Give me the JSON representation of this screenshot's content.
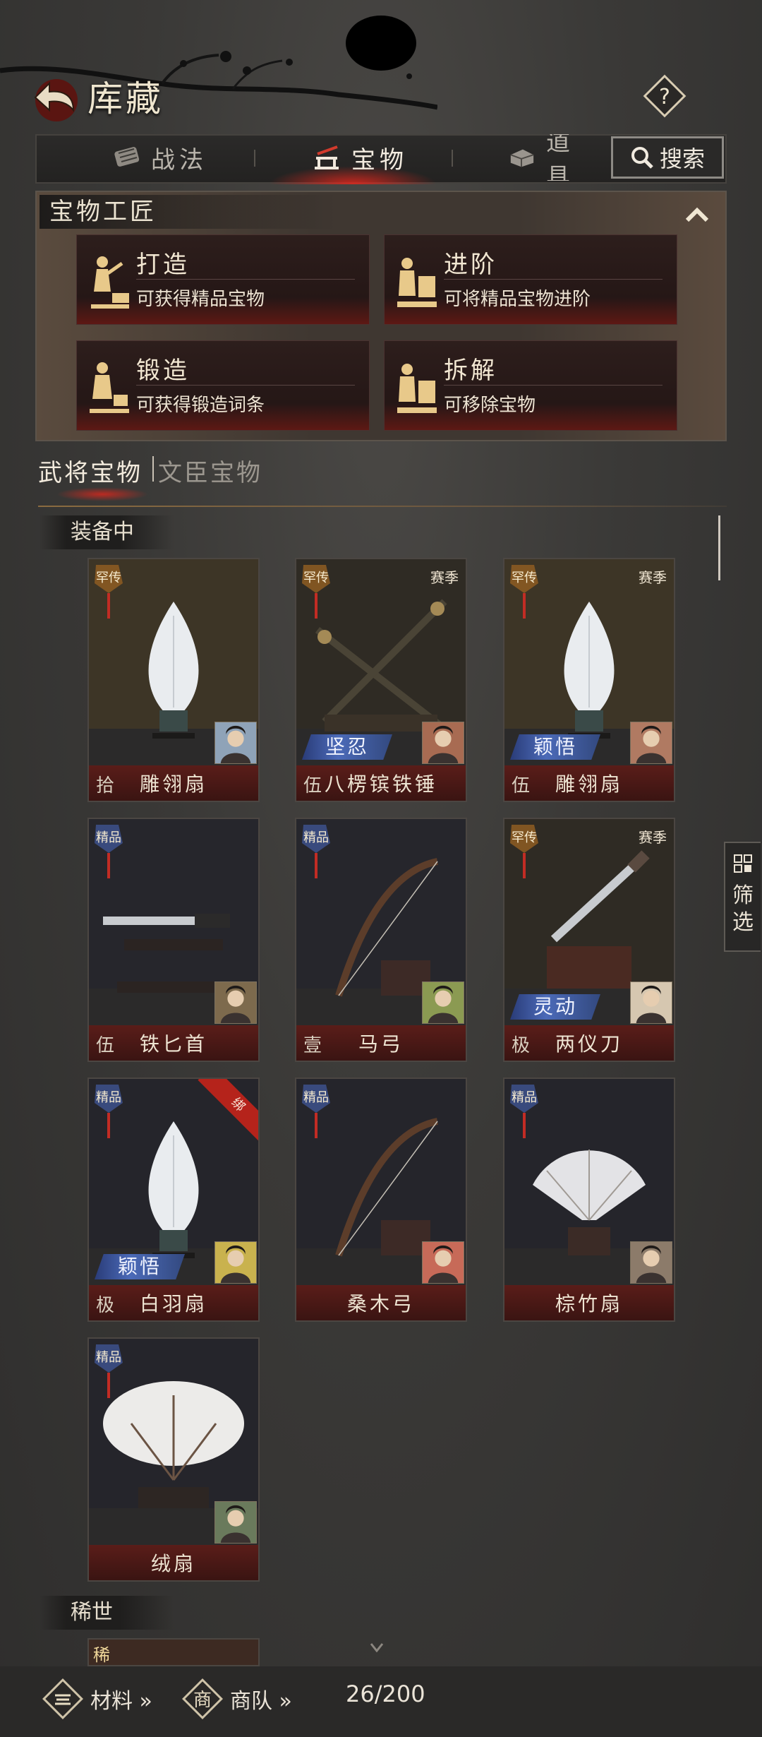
{
  "header": {
    "title": "库藏"
  },
  "tabs": [
    {
      "label": "战法",
      "icon": "scroll-icon"
    },
    {
      "label": "宝物",
      "icon": "sword-stand-icon",
      "active": true
    },
    {
      "label": "道具",
      "icon": "item-box-icon"
    }
  ],
  "search": {
    "label": "搜索"
  },
  "artisan": {
    "title": "宝物工匠",
    "cards": [
      {
        "name": "打造",
        "desc": "可获得精品宝物"
      },
      {
        "name": "进阶",
        "desc": "可将精品宝物进阶"
      },
      {
        "name": "锻造",
        "desc": "可获得锻造词条"
      },
      {
        "name": "拆解",
        "desc": "可移除宝物"
      }
    ]
  },
  "subtabs": {
    "general": "武将宝物",
    "civil": "文臣宝物"
  },
  "sections": {
    "equipped": "装备中",
    "rare": "稀世"
  },
  "items": [
    {
      "name": "雕翎扇",
      "rank": "拾",
      "grade": "罕传",
      "season": "",
      "skill": "",
      "bound": false
    },
    {
      "name": "八楞镔铁锤",
      "rank": "伍",
      "grade": "罕传",
      "season": "赛季",
      "skill": "坚忍",
      "bound": false
    },
    {
      "name": "雕翎扇",
      "rank": "伍",
      "grade": "罕传",
      "season": "赛季",
      "skill": "颖悟",
      "bound": false
    },
    {
      "name": "铁匕首",
      "rank": "伍",
      "grade": "精品",
      "season": "",
      "skill": "",
      "bound": false
    },
    {
      "name": "马弓",
      "rank": "壹",
      "grade": "精品",
      "season": "",
      "skill": "",
      "bound": false
    },
    {
      "name": "两仪刀",
      "rank": "极",
      "grade": "罕传",
      "season": "赛季",
      "skill": "灵动",
      "bound": false
    },
    {
      "name": "白羽扇",
      "rank": "极",
      "grade": "精品",
      "season": "",
      "skill": "颖悟",
      "bound": true,
      "bound_label": "绑"
    },
    {
      "name": "桑木弓",
      "rank": "",
      "grade": "精品",
      "season": "",
      "skill": "",
      "bound": false
    },
    {
      "name": "棕竹扇",
      "rank": "",
      "grade": "精品",
      "season": "",
      "skill": "",
      "bound": false
    },
    {
      "name": "绒扇",
      "rank": "",
      "grade": "精品",
      "season": "",
      "skill": "",
      "bound": false
    }
  ],
  "rare_preview_grade": "稀",
  "filter": {
    "label": "筛选"
  },
  "bottom": {
    "materials": "材料 »",
    "caravan": "商队 »",
    "counter": "26/200"
  },
  "colors": {
    "accent_red": "#b5231b",
    "skill_blue": "#4b6ab8",
    "bar_red": "#5a1d19"
  }
}
